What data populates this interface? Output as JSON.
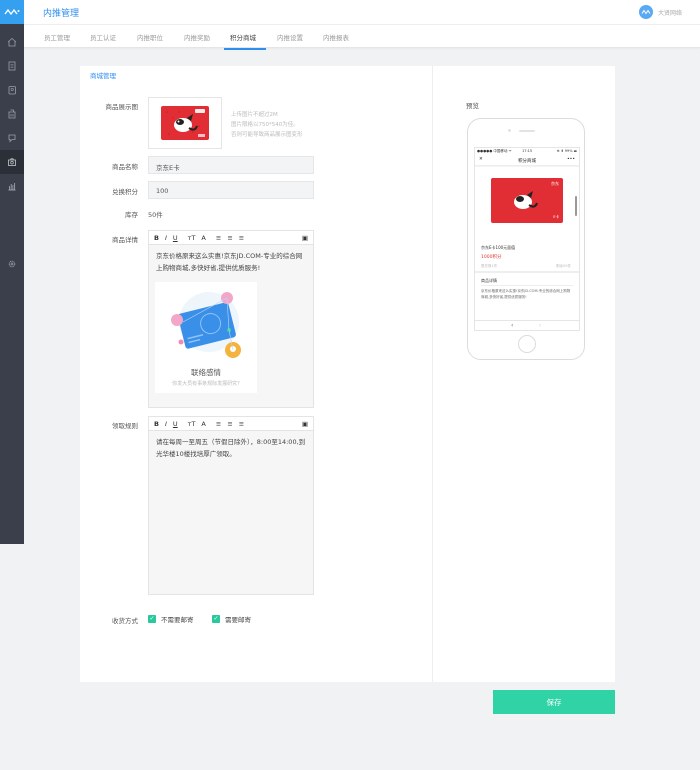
{
  "app": {
    "title": "内推管理",
    "user_name": "大贤网络"
  },
  "tabs": [
    {
      "label": "员工管理"
    },
    {
      "label": "员工认证"
    },
    {
      "label": "内推职位"
    },
    {
      "label": "内推奖励"
    },
    {
      "label": "积分商城",
      "active": true
    },
    {
      "label": "内推设置"
    },
    {
      "label": "内推报表"
    }
  ],
  "sidebar": {
    "icons": [
      "home-icon",
      "document-icon",
      "notebook-icon",
      "building-icon",
      "chat-icon",
      "camera-icon",
      "bar-chart-icon",
      "gear-icon"
    ],
    "active": "camera-icon"
  },
  "form": {
    "section_title": "商城管理",
    "image_label": "商品展示图",
    "hints": [
      "上传图片不超过2M",
      "图片限格以750*540为佳。",
      "否则可能导致商品展示图变形"
    ],
    "name_label": "商品名称",
    "name_value": "京东E卡",
    "points_label": "兑换积分",
    "points_value": "100",
    "stock_label": "库存",
    "stock_value": "50件",
    "detail_label": "商品详情",
    "detail_text": "京东价格原来这么实惠!京东JD.COM-专业的综合网上购物商城,多快好省,提供优质服务!",
    "illus_title": "联络感情",
    "illus_sub": "你发大员有事条规际发展研究?",
    "rules_label": "领取规则",
    "rules_text": "请在每周一至周五（节假日除外），8:00至14:00,到光华楼10楼找培厚广领取。",
    "delivery_label": "收货方式",
    "delivery_options": [
      {
        "label": "不需要邮寄",
        "checked": true
      },
      {
        "label": "需要邮寄",
        "checked": true
      }
    ],
    "toolbar": {
      "bold": "B",
      "italic": "I",
      "underline": "U",
      "font_size": "ᴛT",
      "font_color": "A",
      "ordered": "≡",
      "unordered": "≡",
      "align": "≡",
      "image": "▣"
    }
  },
  "preview": {
    "label": "预览",
    "status_carrier": "●●●●● 中国移动 ᯤ",
    "status_time": "17:15",
    "status_right": "⊕ ⬆ 99% ▬",
    "nav_title": "积分商城",
    "nav_close": "✕",
    "nav_more": "•••",
    "card_brand": "京东",
    "card_value": "E卡",
    "product_name": "京东E卡100元面值",
    "points": "1000积分",
    "meta_left": "限兑换1件",
    "meta_right": "剩余50件",
    "detail_title": "商品详情",
    "detail_text": "京东价格原来这么实惠!京东JD.COM-专业的综合网上购物商城,多快好省,提供优质服务!",
    "back": "‹",
    "forward": "›"
  },
  "save_label": "保存",
  "colors": {
    "accent": "#2e8ef0",
    "save": "#2fd3a5",
    "check": "#28c99d",
    "sidebar": "#3a3f4b",
    "card": "#e12d34"
  }
}
